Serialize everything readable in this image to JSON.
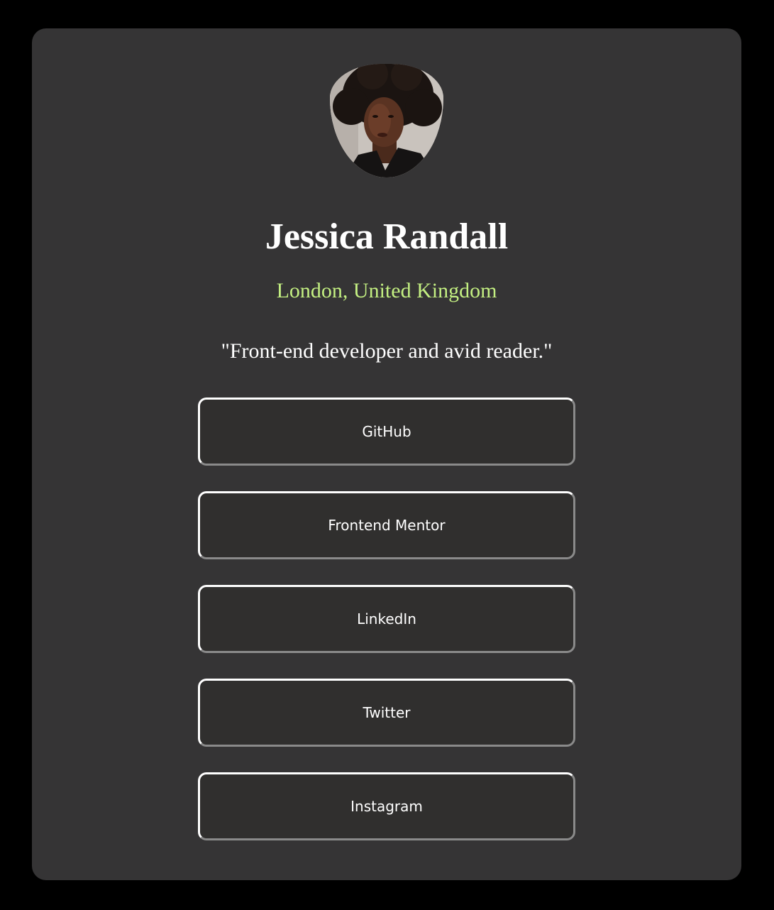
{
  "profile": {
    "name": "Jessica Randall",
    "location": "London, United Kingdom",
    "bio": "\"Front-end developer and avid reader.\""
  },
  "links": [
    {
      "label": "GitHub"
    },
    {
      "label": "Frontend Mentor"
    },
    {
      "label": "LinkedIn"
    },
    {
      "label": "Twitter"
    },
    {
      "label": "Instagram"
    }
  ],
  "colors": {
    "page_background": "#000000",
    "card_background": "#353435",
    "button_background": "#302f2e",
    "accent_green": "#c4f082",
    "text": "#ffffff"
  }
}
